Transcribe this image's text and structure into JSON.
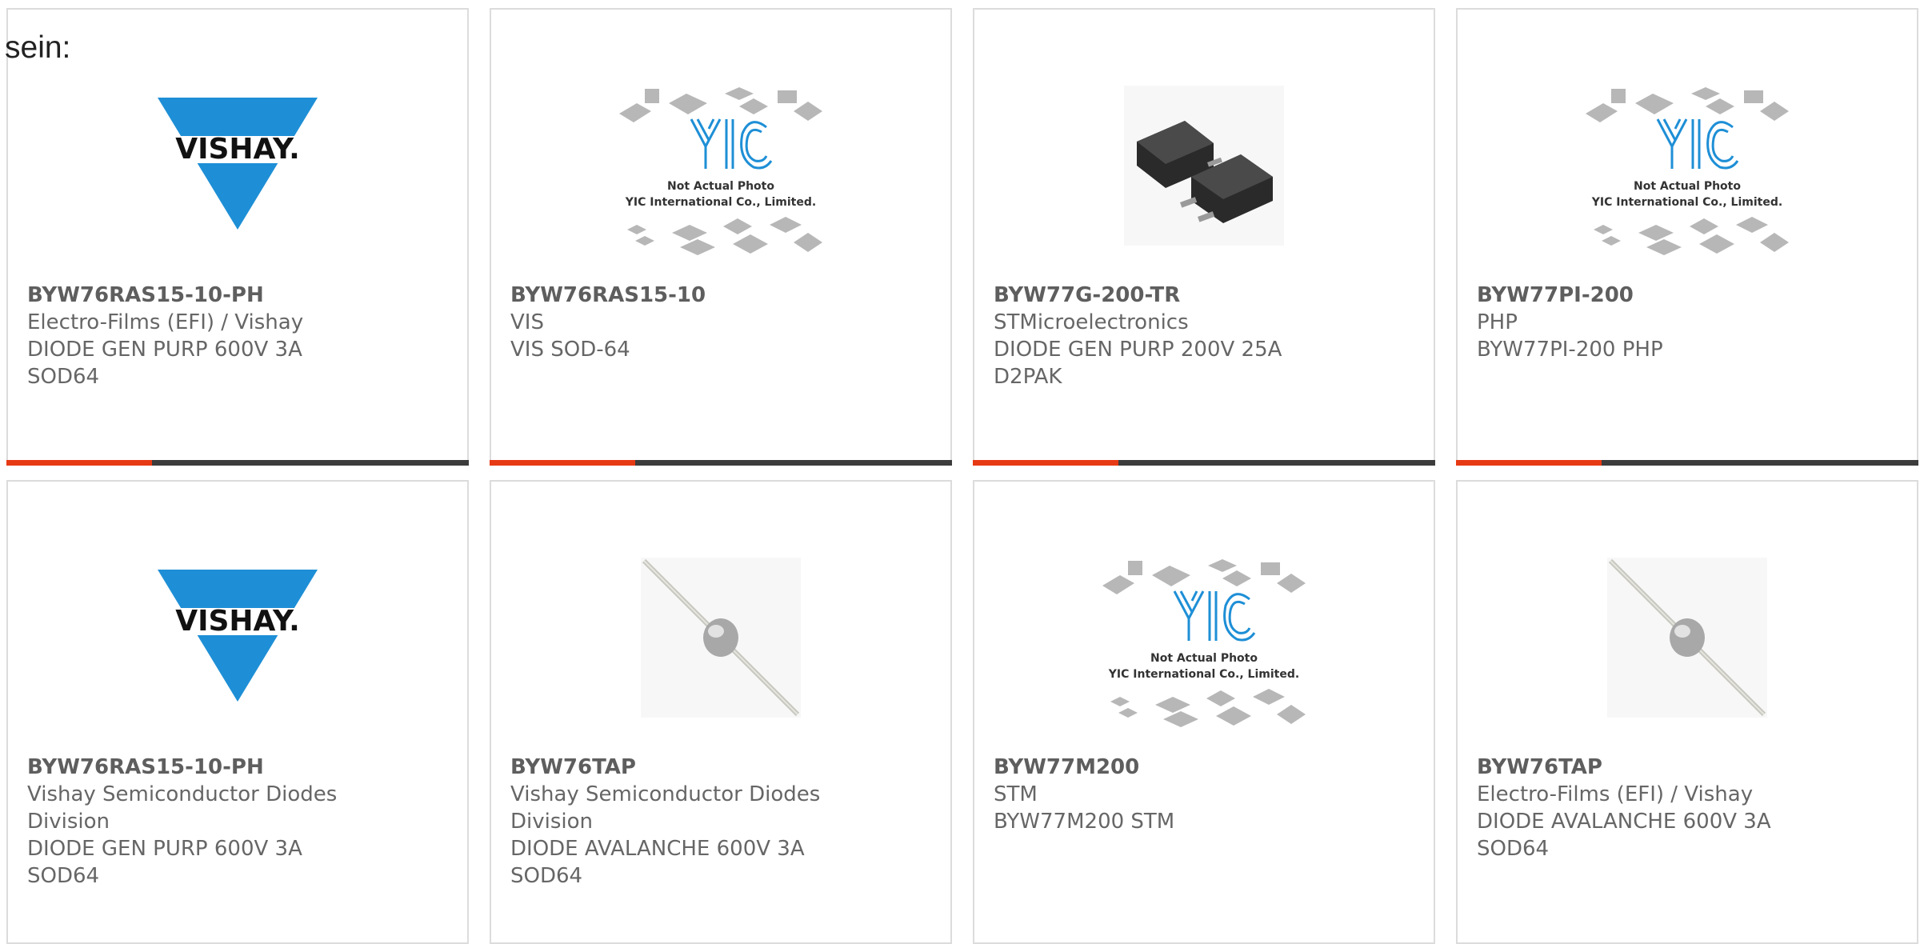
{
  "intro_text": "sein:",
  "colors": {
    "border": "#dcdcdc",
    "accent": "#e63a14",
    "bar": "#3c3c3c",
    "text": "#666666",
    "vishay_blue": "#1e8fd6"
  },
  "products": [
    {
      "image": "vishay-logo",
      "part_number": "BYW76RAS15-10-PH",
      "lines": [
        "Electro-Films (EFI) / Vishay",
        "DIODE GEN PURP 600V 3A",
        "SOD64"
      ]
    },
    {
      "image": "not-actual-photo-placeholder",
      "placeholder_text": [
        "Not Actual Photo",
        "YIC International Co., Limited."
      ],
      "logo_text": "YIC",
      "part_number": "BYW76RAS15-10",
      "lines": [
        "VIS",
        "VIS SOD-64"
      ]
    },
    {
      "image": "d2pak-package-photo",
      "part_number": "BYW77G-200-TR",
      "lines": [
        "STMicroelectronics",
        "DIODE GEN PURP 200V 25A",
        "D2PAK"
      ]
    },
    {
      "image": "not-actual-photo-placeholder",
      "placeholder_text": [
        "Not Actual Photo",
        "YIC International Co., Limited."
      ],
      "logo_text": "YIC",
      "part_number": "BYW77PI-200",
      "lines": [
        "PHP",
        "BYW77PI-200 PHP"
      ]
    },
    {
      "image": "vishay-logo",
      "part_number": "BYW76RAS15-10-PH",
      "lines": [
        "Vishay Semiconductor Diodes",
        "Division",
        "DIODE GEN PURP 600V 3A",
        "SOD64"
      ]
    },
    {
      "image": "axial-diode-photo",
      "part_number": "BYW76TAP",
      "lines": [
        "Vishay Semiconductor Diodes",
        "Division",
        "DIODE AVALANCHE 600V 3A",
        "SOD64"
      ]
    },
    {
      "image": "not-actual-photo-placeholder",
      "placeholder_text": [
        "Not Actual Photo",
        "YIC International Co., Limited."
      ],
      "logo_text": "YIC",
      "part_number": "BYW77M200",
      "lines": [
        "STM",
        "BYW77M200 STM"
      ]
    },
    {
      "image": "axial-diode-photo",
      "part_number": "BYW76TAP",
      "lines": [
        "Electro-Films (EFI) / Vishay",
        "DIODE AVALANCHE 600V 3A",
        "SOD64"
      ]
    }
  ]
}
